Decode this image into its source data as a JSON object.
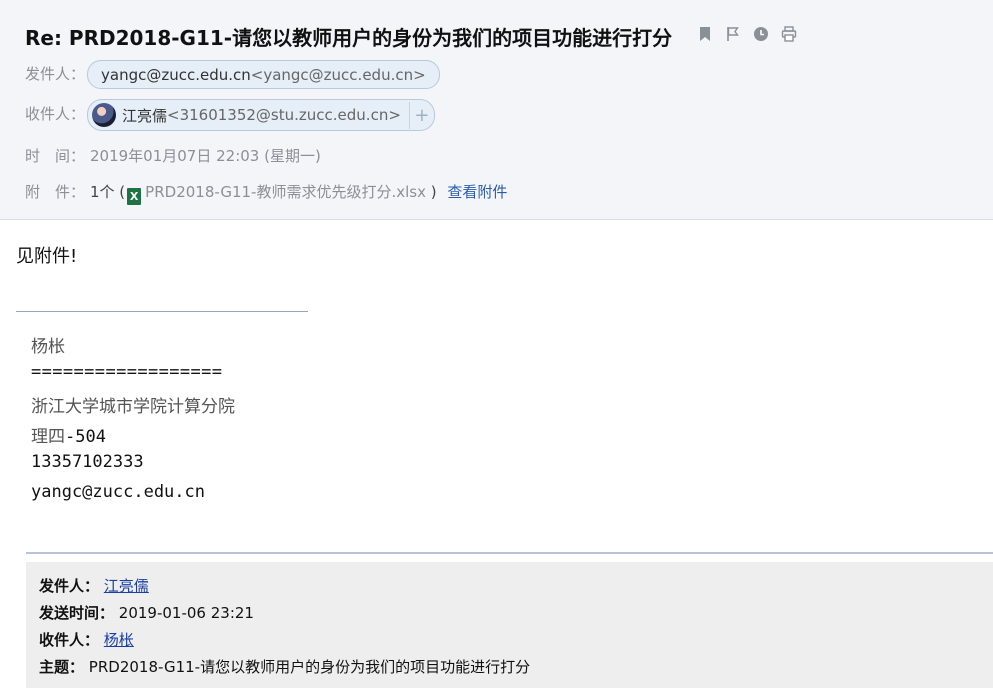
{
  "subject": "Re: PRD2018-G11-请您以教师用户的身份为我们的项目功能进行打分",
  "toolbar": {
    "icons": [
      "bookmark-icon",
      "flag-icon",
      "clock-icon",
      "print-icon"
    ]
  },
  "from": {
    "label": "发件人：",
    "email": "yangc@zucc.edu.cn",
    "addr": "<yangc@zucc.edu.cn>"
  },
  "to": {
    "label": "收件人：",
    "name": "江亮儒",
    "addr": "<31601352@stu.zucc.edu.cn>",
    "plus": "+"
  },
  "time": {
    "label": "时　间：",
    "value": "2019年01月07日 22:03 (星期一)"
  },
  "attachment": {
    "label": "附　件：",
    "count": "1个 (",
    "filename": "PRD2018-G11-教师需求优先级打分.xlsx",
    "close": ")",
    "view_link": "查看附件",
    "file_icon": "X"
  },
  "body": {
    "text": "见附件!"
  },
  "signature": {
    "name": "杨枨",
    "rule": "==================",
    "org": "浙江大学城市学院计算分院",
    "room_prefix": "理四",
    "room_suffix": "-504",
    "phone": "13357102333",
    "email": "yangc@zucc.edu.cn"
  },
  "quote": {
    "from_label": "发件人：",
    "from_value": "江亮儒",
    "sent_label": "发送时间：",
    "sent_value": "2019-01-06 23:21",
    "to_label": "收件人：",
    "to_value": "杨枨",
    "subject_label": "主题：",
    "subject_value": "PRD2018-G11-请您以教师用户的身份为我们的项目功能进行打分"
  }
}
